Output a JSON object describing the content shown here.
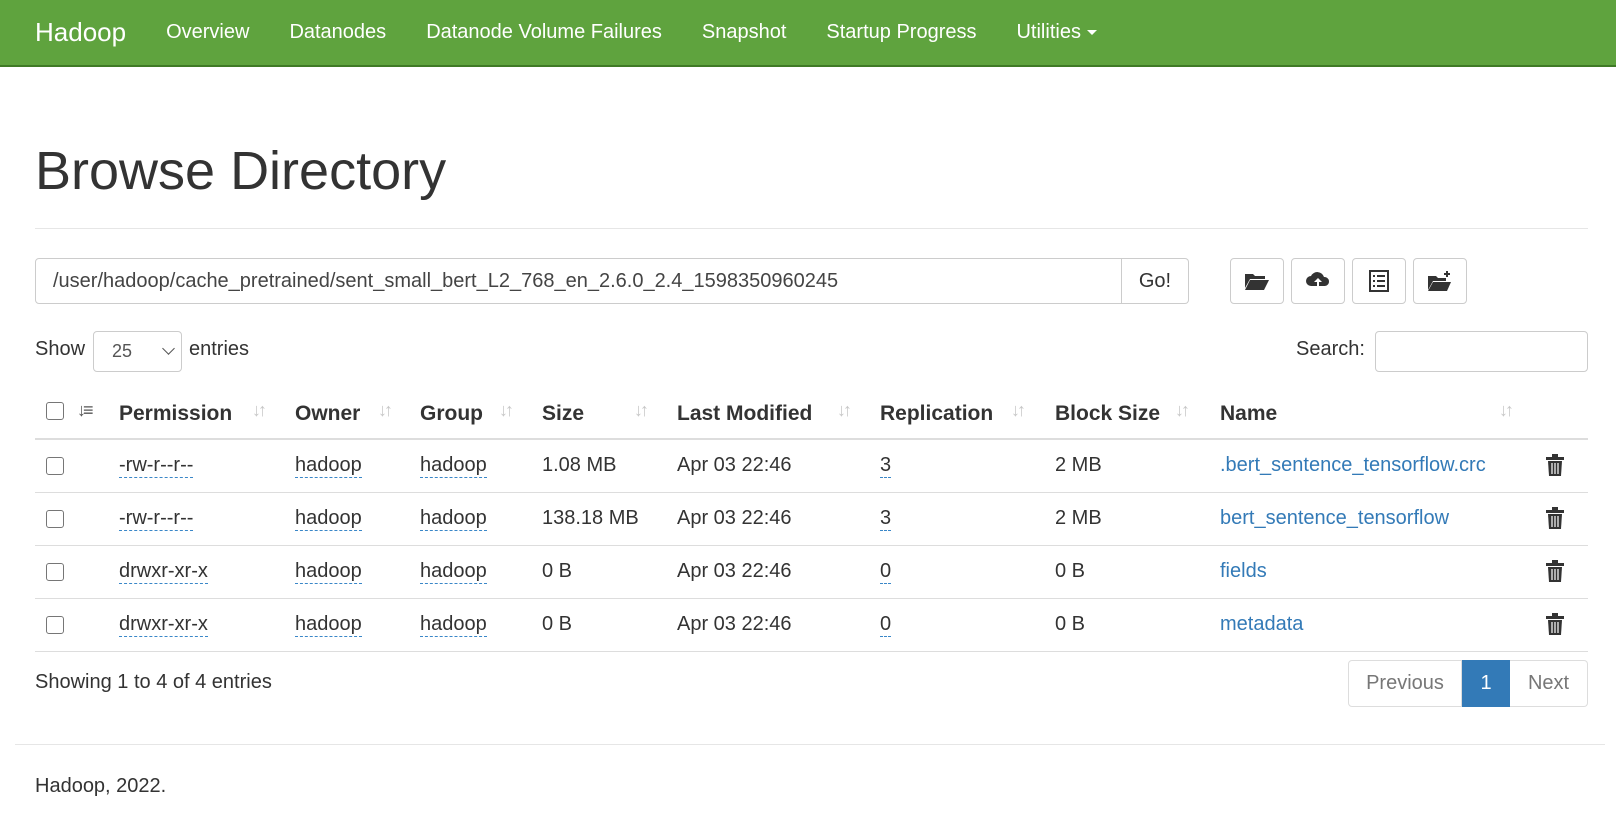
{
  "navbar": {
    "brand": "Hadoop",
    "items": [
      "Overview",
      "Datanodes",
      "Datanode Volume Failures",
      "Snapshot",
      "Startup Progress",
      "Utilities"
    ],
    "color": "#5fa33e"
  },
  "page": {
    "title": "Browse Directory"
  },
  "path_bar": {
    "path": "/user/hadoop/cache_pretrained/sent_small_bert_L2_768_en_2.6.0_2.4_1598350960245",
    "go_label": "Go!",
    "icons": [
      "folder-open-icon",
      "cloud-upload-icon",
      "list-alt-icon",
      "folder-plus-icon"
    ]
  },
  "controls": {
    "show_label": "Show",
    "page_size": "25",
    "entries_label": "entries",
    "search_label": "Search:",
    "search_value": ""
  },
  "table": {
    "columns": [
      "Permission",
      "Owner",
      "Group",
      "Size",
      "Last Modified",
      "Replication",
      "Block Size",
      "Name"
    ],
    "rows": [
      {
        "permission": "-rw-r--r--",
        "owner": "hadoop",
        "group": "hadoop",
        "size": "1.08 MB",
        "modified": "Apr 03 22:46",
        "replication": "3",
        "block_size": "2 MB",
        "name": ".bert_sentence_tensorflow.crc"
      },
      {
        "permission": "-rw-r--r--",
        "owner": "hadoop",
        "group": "hadoop",
        "size": "138.18 MB",
        "modified": "Apr 03 22:46",
        "replication": "3",
        "block_size": "2 MB",
        "name": "bert_sentence_tensorflow"
      },
      {
        "permission": "drwxr-xr-x",
        "owner": "hadoop",
        "group": "hadoop",
        "size": "0 B",
        "modified": "Apr 03 22:46",
        "replication": "0",
        "block_size": "0 B",
        "name": "fields"
      },
      {
        "permission": "drwxr-xr-x",
        "owner": "hadoop",
        "group": "hadoop",
        "size": "0 B",
        "modified": "Apr 03 22:46",
        "replication": "0",
        "block_size": "0 B",
        "name": "metadata"
      }
    ]
  },
  "pagination": {
    "info": "Showing 1 to 4 of 4 entries",
    "previous": "Previous",
    "current": "1",
    "next": "Next"
  },
  "footer": {
    "text": "Hadoop, 2022."
  }
}
